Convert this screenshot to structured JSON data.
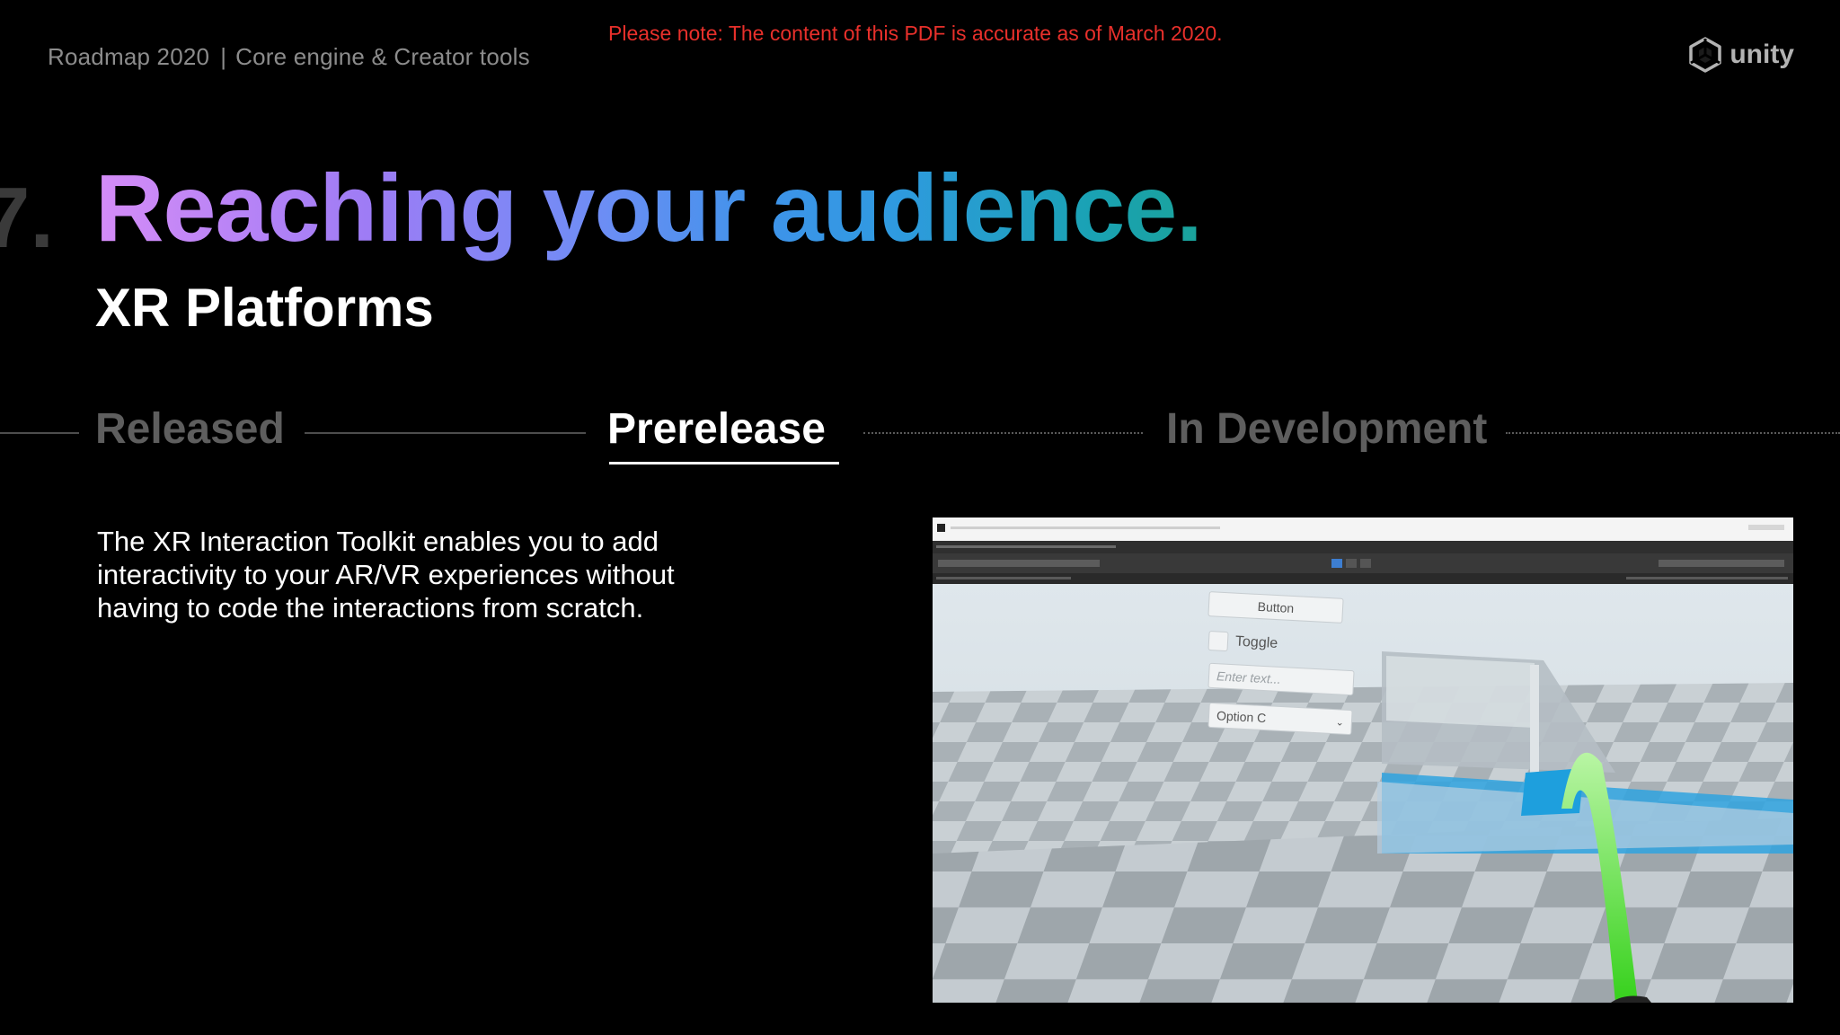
{
  "header": {
    "breadcrumb_title": "Roadmap 2020",
    "breadcrumb_separator": "|",
    "breadcrumb_section": "Core engine & Creator tools",
    "notice": "Please note: The content of this PDF is accurate as of March 2020.",
    "logo_text": "unity",
    "logo_icon": "unity-cube-icon"
  },
  "section": {
    "number": "7.",
    "headline": "Reaching your audience.",
    "subtitle": "XR Platforms"
  },
  "stages": {
    "released": "Released",
    "prerelease": "Prerelease",
    "in_development": "In Development",
    "active": "Prerelease"
  },
  "content": {
    "body": "The XR Interaction Toolkit enables you to add interactivity to your AR/VR experiences without having to code the interactions from scratch."
  },
  "vr_demo": {
    "button_label": "Button",
    "toggle_label": "Toggle",
    "input_placeholder": "Enter text...",
    "dropdown_value": "Option C"
  },
  "colors": {
    "background": "#000000",
    "notice": "#e8302b",
    "inactive_stage": "#5e5e5e",
    "gradient_start": "#d58cf7",
    "gradient_mid": "#3f93ea",
    "gradient_end": "#1aa39a"
  }
}
